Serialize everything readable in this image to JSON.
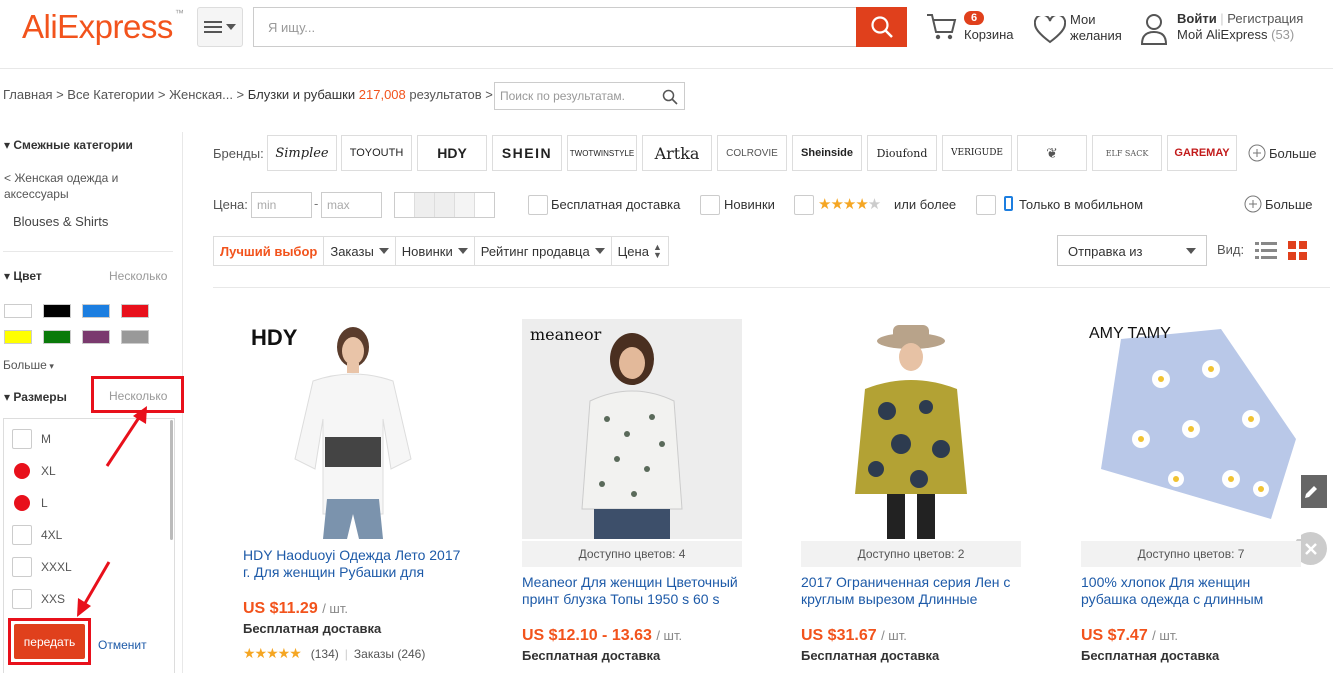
{
  "header": {
    "logo": "AliExpress",
    "search_placeholder": "Я ищу...",
    "cart_count": "6",
    "cart_label": "Корзина",
    "wishlist_line1": "Мои",
    "wishlist_line2": "желания",
    "login": "Войти",
    "register": "Регистрация",
    "my_ali": "Мой AliExpress",
    "my_ali_count": "(53)"
  },
  "breadcrumb": {
    "path": "Главная > Все Категории > Женская... >",
    "current": "Блузки и рубашки",
    "count": "217,008",
    "results": "результатов >",
    "search_placeholder": "Поиск по результатам."
  },
  "sidebar": {
    "related_title": "Смежные категории",
    "back_link": "< Женская одежда и аксессуары",
    "category": "Blouses & Shirts",
    "color_title": "Цвет",
    "color_multi": "Несколько",
    "colors": [
      "#ffffff",
      "#000000",
      "#1c7ee0",
      "#e8101b",
      "#ffff00",
      "#0a7a0a",
      "#7a3a6e",
      "#999999"
    ],
    "more": "Больше",
    "size_title": "Размеры",
    "size_multi": "Несколько",
    "sizes": [
      {
        "label": "M",
        "checked": false
      },
      {
        "label": "XL",
        "checked": true
      },
      {
        "label": "L",
        "checked": true
      },
      {
        "label": "4XL",
        "checked": false
      },
      {
        "label": "XXXL",
        "checked": false
      },
      {
        "label": "XXS",
        "checked": false
      }
    ],
    "submit": "передать",
    "cancel": "Отменит"
  },
  "filters": {
    "brands_label": "Бренды:",
    "brands": [
      "Simplee",
      "TOYOUTH",
      "HDY",
      "SHEIN",
      "TWOTWINSTYLE",
      "Artka",
      "COLROVIE",
      "Sheinside",
      "Dioufond",
      "VERIGUDE",
      "",
      "ELF SACK",
      "GAREMAY"
    ],
    "brands_more": "Больше",
    "price_label": "Цена:",
    "price_min": "min",
    "price_max": "max",
    "free_shipping": "Бесплатная доставка",
    "new_items": "Новинки",
    "rating_suffix": "или более",
    "mobile_only": "Только в мобильном",
    "filters_more": "Больше"
  },
  "sort": {
    "best": "Лучший выбор",
    "orders": "Заказы",
    "new": "Новинки",
    "seller_rating": "Рейтинг продавца",
    "price": "Цена",
    "ship_from": "Отправка из",
    "view_label": "Вид:"
  },
  "products": [
    {
      "brand_mark": "HDY",
      "colors": "",
      "title": "HDY Haoduoyi Одежда Лето 2017 г. Для женщин Рубашки для",
      "price": "US $11.29",
      "unit": "/ шт.",
      "shipping": "Бесплатная доставка",
      "reviews": "(134)",
      "orders": "Заказы (246)",
      "rating": 5
    },
    {
      "brand_mark": "meaneor",
      "colors": "Доступно цветов: 4",
      "title": "Meaneor Для женщин Цветочный принт блузка Топы 1950 s 60 s",
      "price": "US $12.10 - 13.63",
      "unit": "/ шт.",
      "shipping": "Бесплатная доставка"
    },
    {
      "brand_mark": "",
      "colors": "Доступно цветов: 2",
      "title": "2017 Ограниченная серия Лен с круглым вырезом Длинные",
      "price": "US $31.67",
      "unit": "/ шт.",
      "shipping": "Бесплатная доставка"
    },
    {
      "brand_mark": "AMY TAMY",
      "colors": "Доступно цветов: 7",
      "title": "100% хлопок Для женщин рубашка одежда с длинным",
      "price": "US $7.47",
      "unit": "/ шт.",
      "shipping": "Бесплатная доставка"
    }
  ],
  "accent": "#f2531c",
  "highlight": "#e8101b"
}
